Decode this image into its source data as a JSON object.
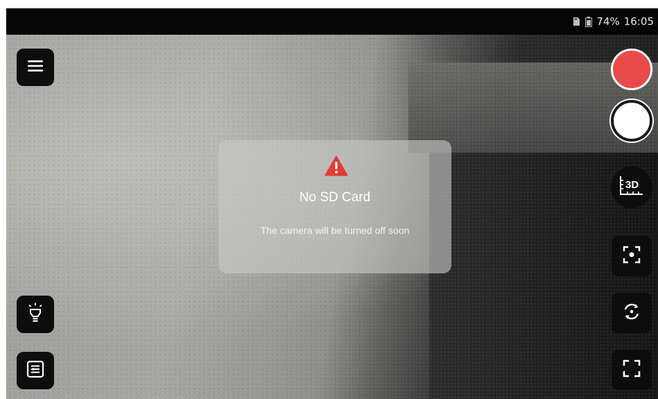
{
  "status_bar": {
    "battery": "74%",
    "time": "16:05",
    "icons": [
      "sd-card-icon",
      "battery-icon"
    ]
  },
  "left_controls": [
    "menu-icon",
    "light-bulb-icon",
    "settings-panel-icon"
  ],
  "right_controls": {
    "record_color": "#e84a4a",
    "three_d_label": "3D",
    "icons": [
      "focus-icon",
      "rotate-icon",
      "fullscreen-icon"
    ]
  },
  "dialog": {
    "title": "No SD Card",
    "message": "The camera will be turned off soon",
    "icon": "warning-icon",
    "icon_color": "#e53935"
  }
}
